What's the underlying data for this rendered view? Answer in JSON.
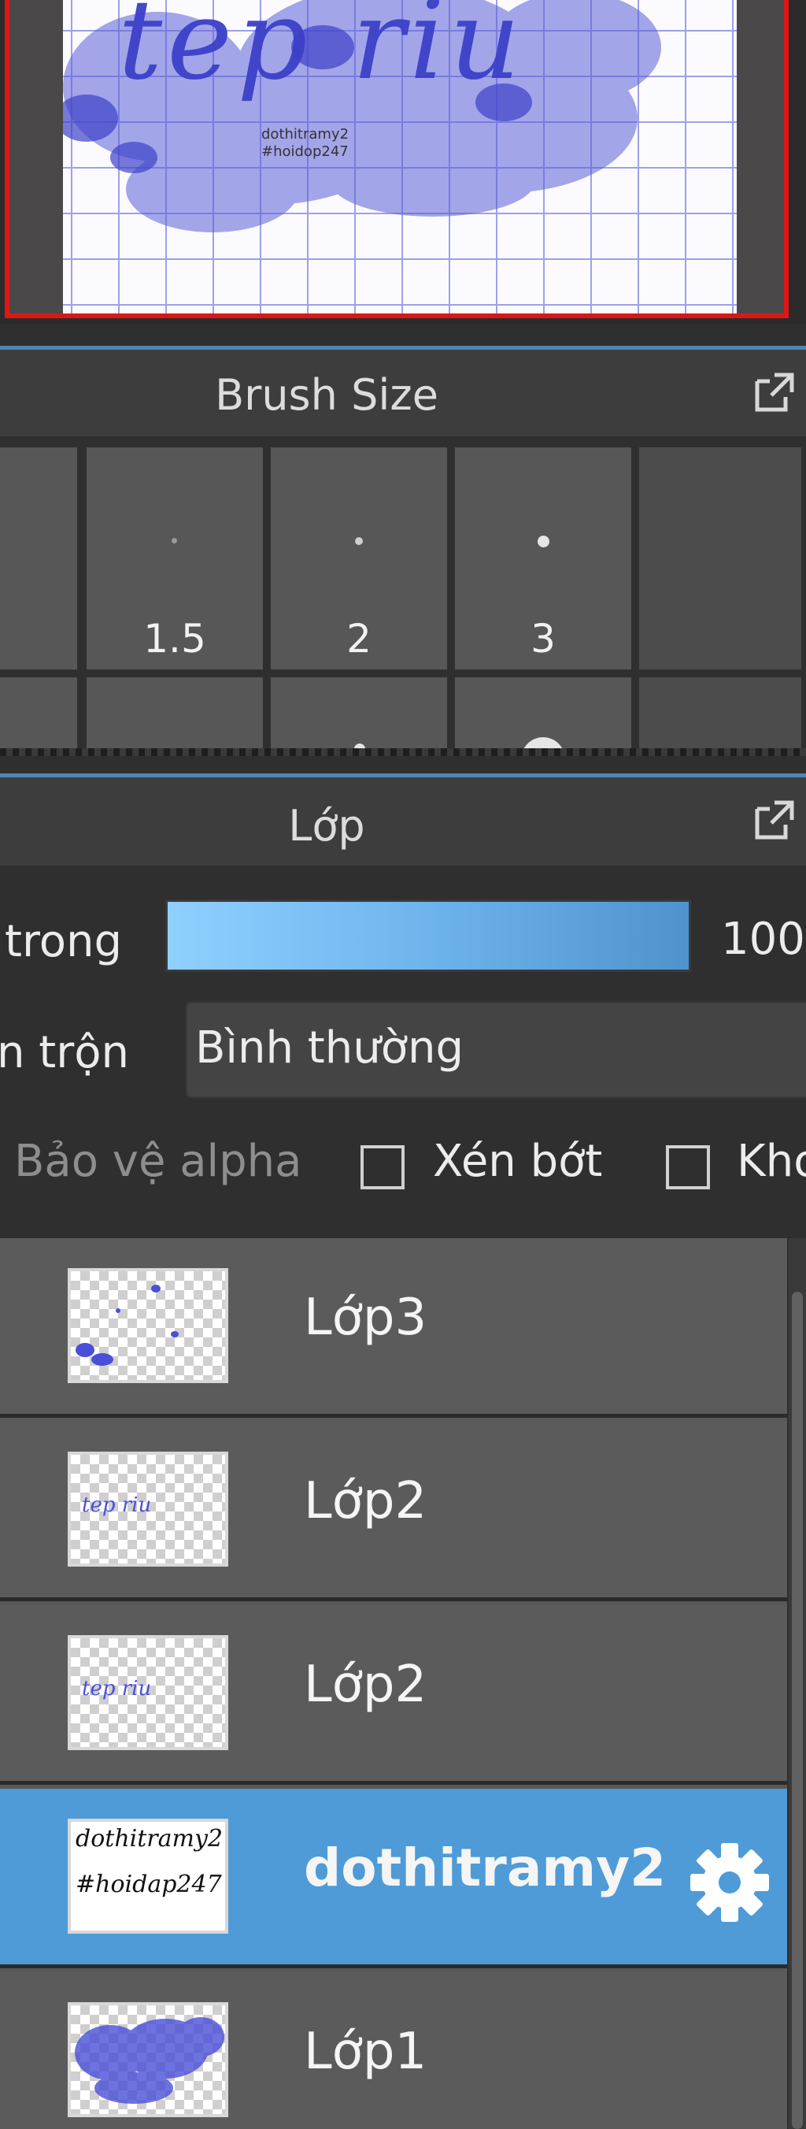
{
  "navigator": {
    "canvas_text": "tep riu",
    "watermark": "dothitramy2 #hoidop247"
  },
  "brush_panel": {
    "title": "Brush Size",
    "sizes": [
      "1.5",
      "2",
      "3"
    ]
  },
  "layer_panel": {
    "title": "Lớp",
    "opacity_label": "trong",
    "opacity_value": "100",
    "opacity_percent": 100,
    "blend_label": "n trộn",
    "blend_mode": "Bình thường",
    "protect_alpha_label": "Bảo vệ alpha",
    "clipping_label": "Xén bớt",
    "lock_label": "Kho",
    "layers": [
      {
        "name": "Lớp3",
        "selected": false
      },
      {
        "name": "Lớp2",
        "selected": false
      },
      {
        "name": "Lớp2",
        "selected": false
      },
      {
        "name": "dothitramy2",
        "selected": true,
        "thumb_text_1": "dothitramy2",
        "thumb_text_2": "#hoidap247"
      },
      {
        "name": "Lớp1",
        "selected": false
      }
    ]
  },
  "colors": {
    "accent_blue": "#4e9bd8",
    "frame_red": "#e01616",
    "ink_blue": "#4a4fd8"
  },
  "icons": {
    "popout": "external-window-icon",
    "settings": "gear-icon"
  }
}
